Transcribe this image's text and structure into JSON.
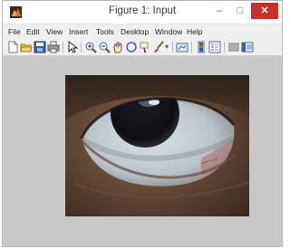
{
  "window": {
    "title": "Figure 1: Input",
    "minimize_glyph": "–",
    "maximize_glyph": "□",
    "close_glyph": "✕"
  },
  "menubar": {
    "items": [
      "File",
      "Edit",
      "View",
      "Insert",
      "Tools",
      "Desktop",
      "Window",
      "Help"
    ]
  },
  "toolbar": {
    "icons": [
      "new-figure-icon",
      "open-file-icon",
      "save-icon",
      "print-icon",
      "edit-plot-icon",
      "zoom-in-icon",
      "zoom-out-icon",
      "pan-icon",
      "rotate-3d-icon",
      "data-cursor-icon",
      "brush-icon",
      "link-plot-icon",
      "colorbar-icon",
      "legend-icon",
      "hide-plot-tools-icon",
      "show-plot-tools-icon"
    ]
  },
  "figure": {
    "image_subject": "close-up photograph of an eye",
    "background_color": "#c8c8c8"
  }
}
